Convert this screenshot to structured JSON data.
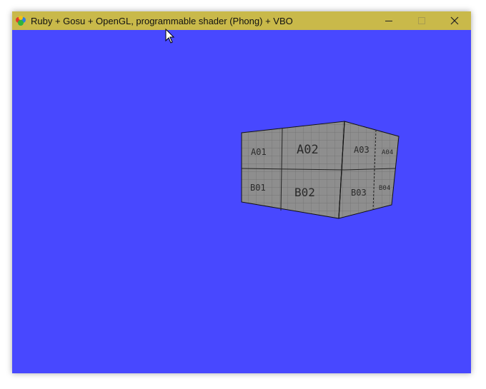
{
  "window": {
    "title": "Ruby + Gosu + OpenGL, programmable shader (Phong) + VBO",
    "background_color": "#4848ff",
    "titlebar_color": "#c9b94a"
  },
  "controls": {
    "minimize_icon": "minimize-icon",
    "maximize_icon": "maximize-icon",
    "close_icon": "close-icon"
  },
  "scene": {
    "object": "textured-box",
    "face_labels": {
      "a01": "A01",
      "a02": "A02",
      "a03": "A03",
      "a04": "A04",
      "b01": "B01",
      "b02": "B02",
      "b03": "B03",
      "b04": "B04"
    }
  }
}
